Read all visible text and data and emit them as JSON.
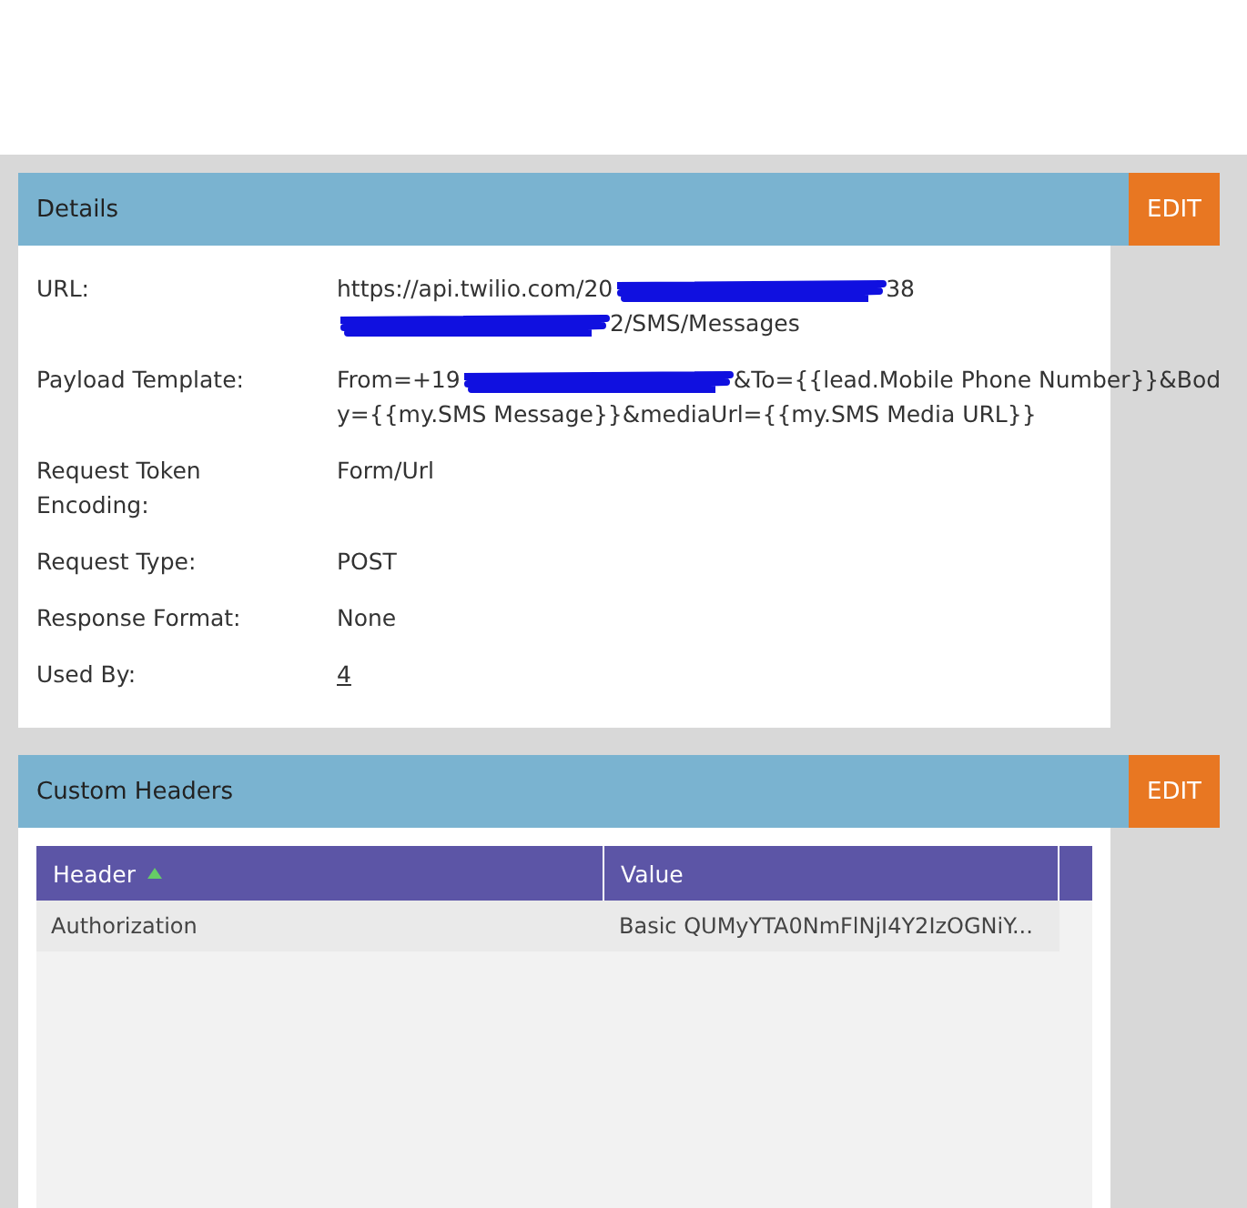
{
  "details": {
    "title": "Details",
    "edit": "EDIT",
    "fields": [
      {
        "label": "URL:",
        "parts": [
          {
            "kind": "text",
            "text": "https://api.twilio.com/20"
          },
          {
            "kind": "redaction"
          },
          {
            "kind": "text",
            "text": "38"
          },
          {
            "kind": "break"
          },
          {
            "kind": "redaction"
          },
          {
            "kind": "text",
            "text": "2/SMS/Messages"
          }
        ]
      },
      {
        "label": "Payload Template:",
        "parts": [
          {
            "kind": "text",
            "text": "From=+19"
          },
          {
            "kind": "redaction"
          },
          {
            "kind": "text",
            "text": "&To={{lead.Mobile Phone Number}}&Bod"
          },
          {
            "kind": "break"
          },
          {
            "kind": "text",
            "text": "y={{my.SMS Message}}&mediaUrl={{my.SMS Media URL}}"
          }
        ]
      },
      {
        "label": "Request Token Encoding:",
        "parts": [
          {
            "kind": "text",
            "text": "Form/Url"
          }
        ]
      },
      {
        "label": "Request Type:",
        "parts": [
          {
            "kind": "text",
            "text": "POST"
          }
        ]
      },
      {
        "label": "Response Format:",
        "parts": [
          {
            "kind": "text",
            "text": "None"
          }
        ]
      },
      {
        "label": "Used By:",
        "parts": [
          {
            "kind": "link",
            "text": "4"
          }
        ]
      }
    ]
  },
  "custom_headers": {
    "title": "Custom Headers",
    "edit": "EDIT",
    "columns": [
      "Header",
      "Value"
    ],
    "rows": [
      [
        "Authorization",
        "Basic QUMyYTA0NmFlNjI4Y2IzOGNiY..."
      ]
    ]
  }
}
